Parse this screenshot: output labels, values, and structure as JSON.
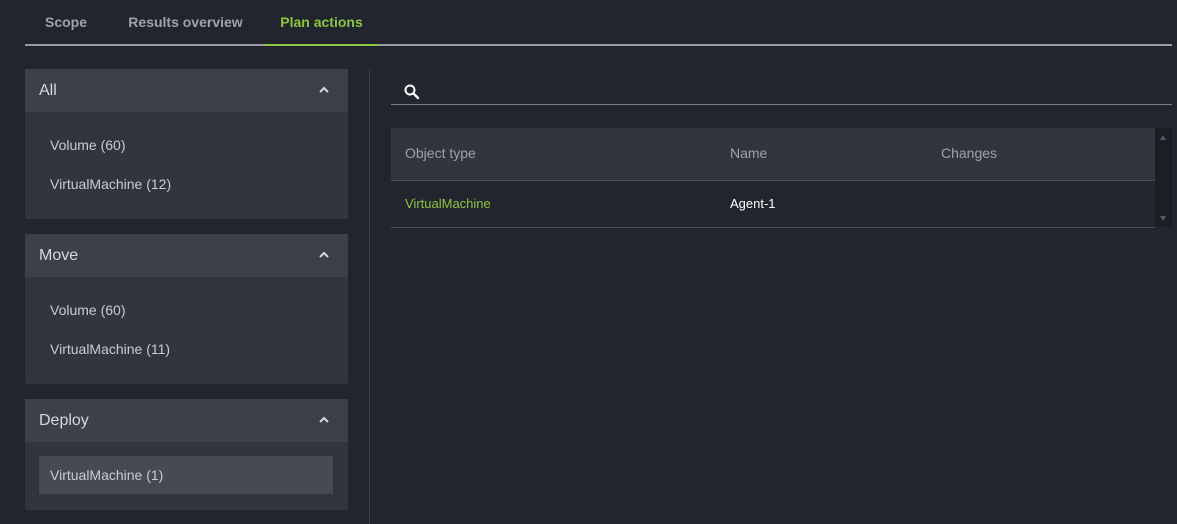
{
  "tabs": [
    {
      "label": "Scope",
      "active": false
    },
    {
      "label": "Results overview",
      "active": false
    },
    {
      "label": "Plan actions",
      "active": true
    }
  ],
  "panels": [
    {
      "title": "All",
      "items": [
        "Volume (60)",
        "VirtualMachine (12)"
      ]
    },
    {
      "title": "Move",
      "items": [
        "Volume (60)",
        "VirtualMachine (11)"
      ]
    },
    {
      "title": "Deploy",
      "items": [
        "VirtualMachine (1)"
      ],
      "selected_index": 0
    }
  ],
  "search": {
    "value": "",
    "placeholder": ""
  },
  "table": {
    "columns": [
      "Object type",
      "Name",
      "Changes"
    ],
    "rows": [
      {
        "object_type": "VirtualMachine",
        "name": "Agent-1",
        "changes": ""
      }
    ]
  },
  "colors": {
    "accent": "#8dc63f",
    "background": "#22252e",
    "panel": "#31353f"
  },
  "icons": {
    "search": "search-icon",
    "collapse": "chevron-up-icon"
  }
}
